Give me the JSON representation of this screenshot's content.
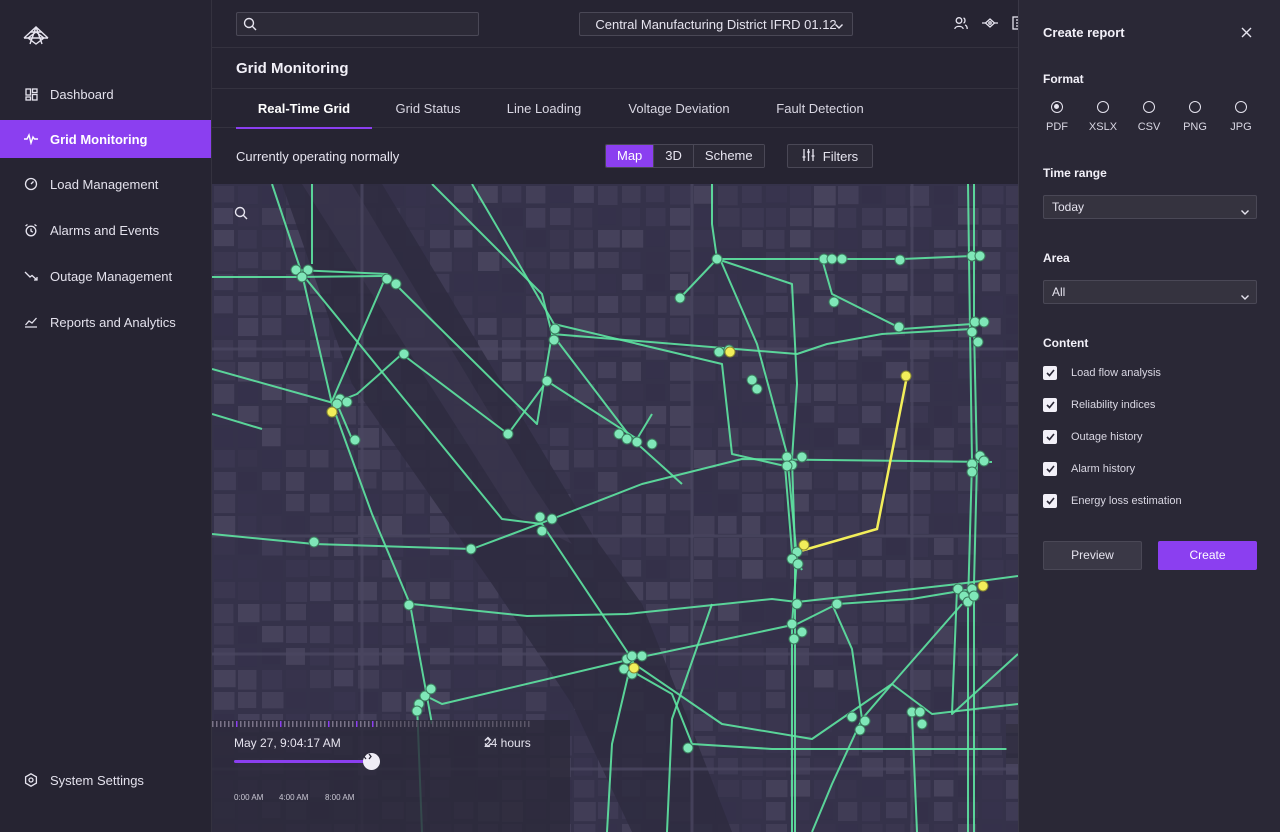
{
  "sidebar": {
    "logo": "tower-logo",
    "items": [
      {
        "label": "Dashboard",
        "icon": "dashboard-icon"
      },
      {
        "label": "Grid Monitoring",
        "icon": "pulse-icon",
        "active": true
      },
      {
        "label": "Load Management",
        "icon": "gauge-icon"
      },
      {
        "label": "Alarms and Events",
        "icon": "alarm-icon"
      },
      {
        "label": "Outage Management",
        "icon": "trend-down-icon"
      },
      {
        "label": "Reports and Analytics",
        "icon": "chart-line-icon"
      }
    ],
    "settings_label": "System Settings"
  },
  "topbar": {
    "search_placeholder": "",
    "district": "Central Manufacturing District IFRD 01.12"
  },
  "page": {
    "title": "Grid Monitoring",
    "tabs": [
      "Real-Time Grid",
      "Grid Status",
      "Line Loading",
      "Voltage Deviation",
      "Fault Detection"
    ],
    "active_tab": 0,
    "status": "Currently operating normally",
    "views": [
      "Map",
      "3D",
      "Scheme"
    ],
    "active_view": 0,
    "filters_label": "Filters"
  },
  "timeline": {
    "datetime": "May 27, 9:04:17 AM",
    "range": "24 hours",
    "progress": 0.43,
    "labels": [
      "0:00 AM",
      "4:00 AM",
      "8:00 AM"
    ]
  },
  "report": {
    "title": "Create report",
    "format_label": "Format",
    "formats": [
      "PDF",
      "XSLX",
      "CSV",
      "PNG",
      "JPG"
    ],
    "selected_format": 0,
    "time_label": "Time range",
    "time_value": "Today",
    "area_label": "Area",
    "area_value": "All",
    "content_label": "Content",
    "content_items": [
      "Load flow analysis",
      "Reliability indices",
      "Outage history",
      "Alarm history",
      "Energy loss estimation"
    ],
    "preview_label": "Preview",
    "create_label": "Create"
  },
  "colors": {
    "accent": "#8b3ff0",
    "grid_line": "#5ee6a2",
    "fault_line": "#f2ee5a"
  }
}
